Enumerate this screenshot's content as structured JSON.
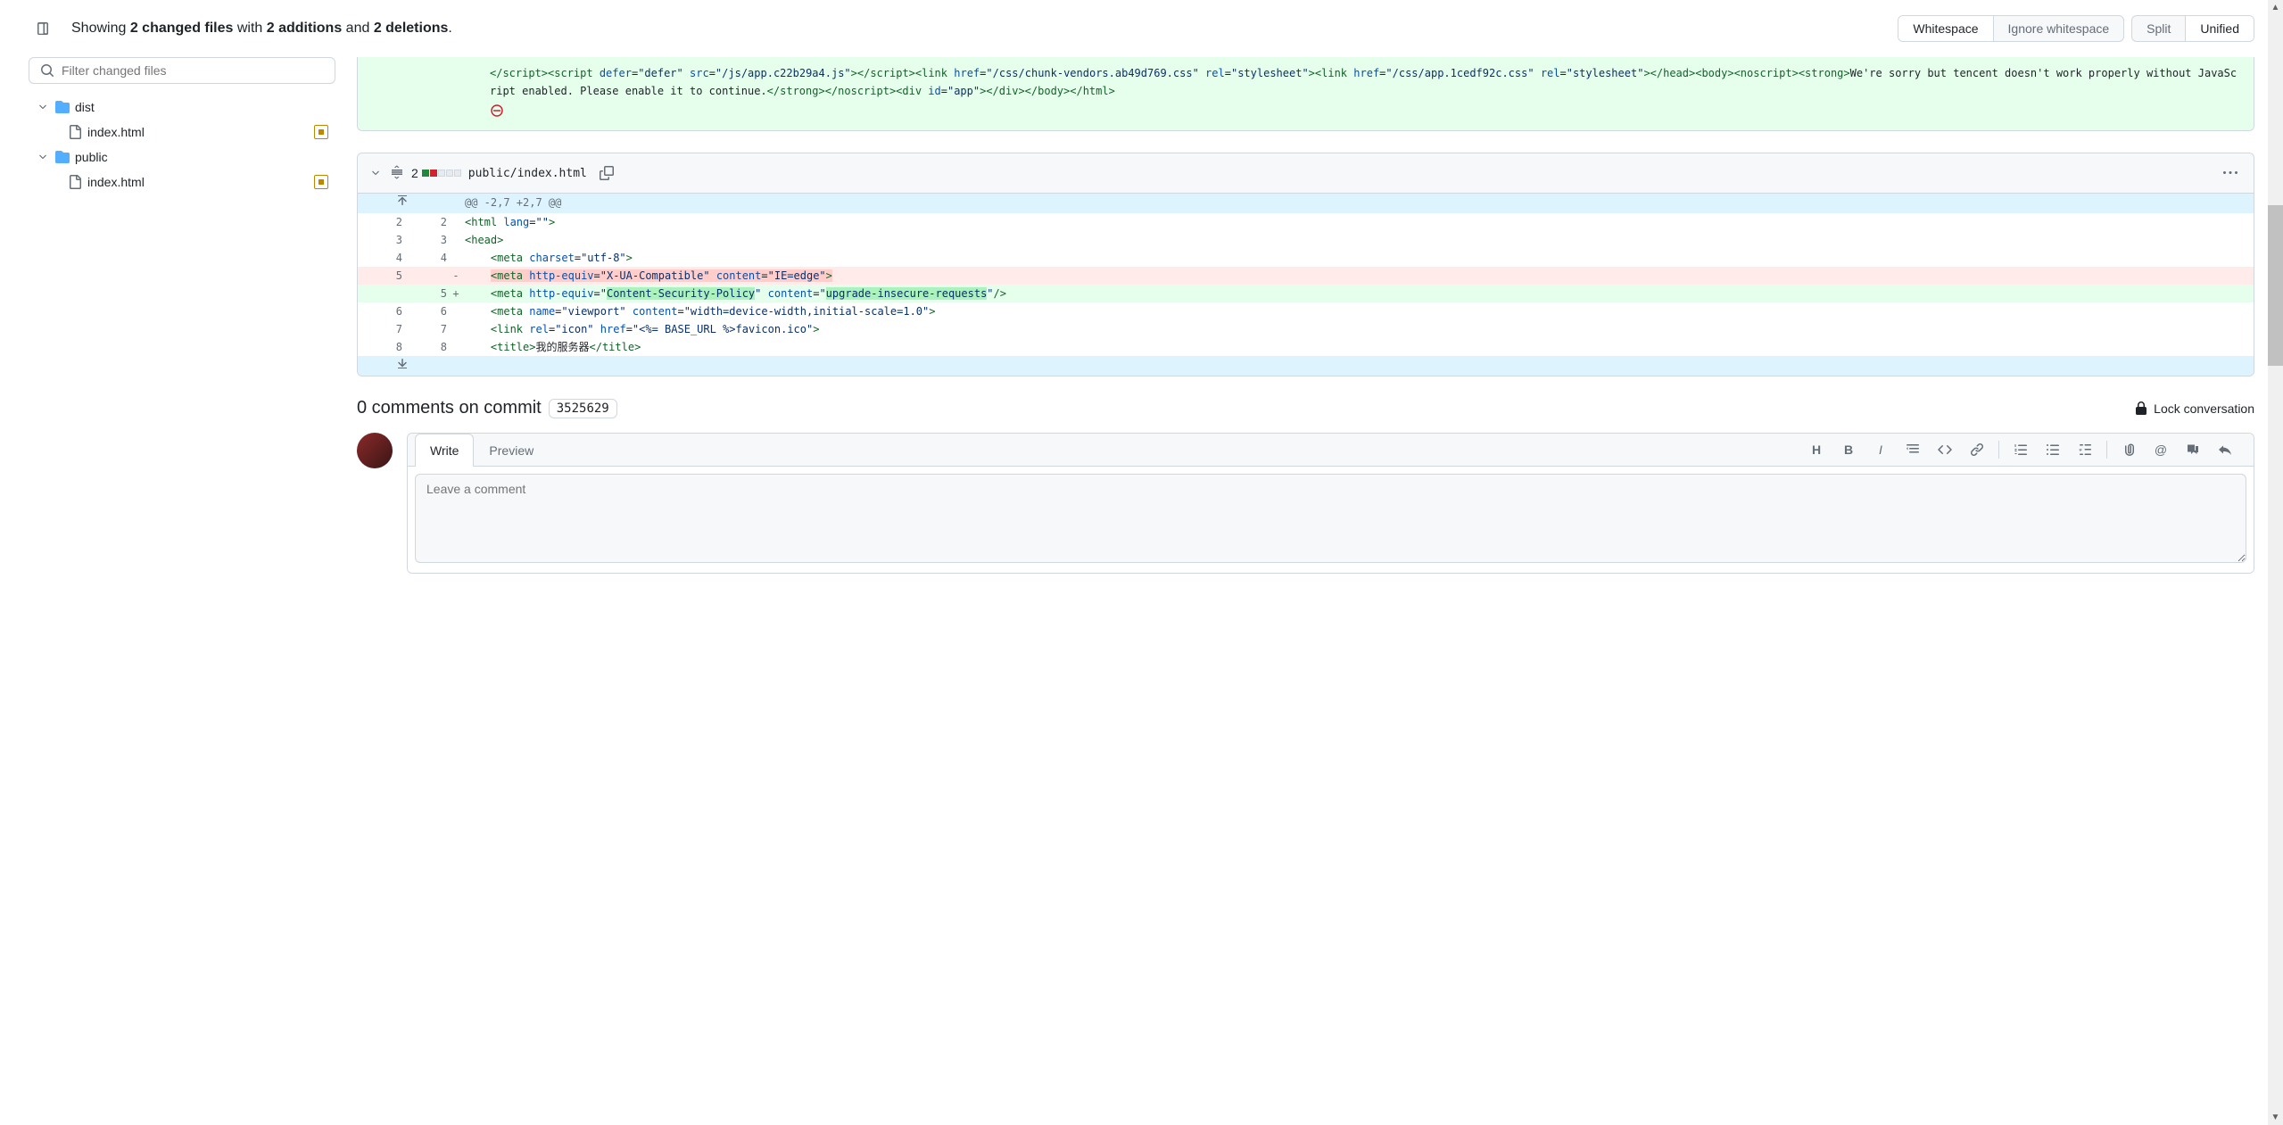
{
  "summary": {
    "prefix": "Showing ",
    "changed_files": "2 changed files",
    "with": " with ",
    "additions": "2 additions",
    "and": " and ",
    "deletions": "2 deletions",
    "suffix": "."
  },
  "view_toggles": {
    "whitespace": "Whitespace",
    "ignore_whitespace": "Ignore whitespace",
    "split": "Split",
    "unified": "Unified"
  },
  "filter_placeholder": "Filter changed files",
  "tree": {
    "dist": "dist",
    "dist_index": "index.html",
    "public": "public",
    "public_index": "index.html"
  },
  "file1_snippet": "</script\\>\\<script defer=\"defer\" src=\"/js/app.c22b29a4.js\"\\>\\</script\\>\\<link href=\"/css/chunk-vendors.ab49d769.css\" rel=\"stylesheet\"\\>\\<link href=\"/css/app.1cedf92c.css\" rel=\"stylesheet\"\\>\\</head\\>\\<body\\>\\<noscript\\>\\<strong\\>We're sorry but tencent doesn't work properly without JavaScript enabled. Please enable it to continue.\\</strong\\>\\</noscript\\>\\<div id=\"app\"\\>\\</div\\>\\</body\\>\\</html\\>",
  "file2": {
    "change_count": "2",
    "path": "public/index.html",
    "hunk": "@@ -2,7 +2,7 @@",
    "lines": {
      "l2_old": "2",
      "l2_new": "2",
      "l3_old": "3",
      "l3_new": "3",
      "l4_old": "4",
      "l4_new": "4",
      "l5_old": "5",
      "l5_new": "5",
      "l6_old": "6",
      "l6_new": "6",
      "l7_old": "7",
      "l7_new": "7",
      "l8_old": "8",
      "l8_new": "8"
    }
  },
  "comments": {
    "title_prefix": "0 comments on commit",
    "sha": "3525629",
    "lock": "Lock conversation",
    "write_tab": "Write",
    "preview_tab": "Preview",
    "placeholder": "Leave a comment"
  }
}
